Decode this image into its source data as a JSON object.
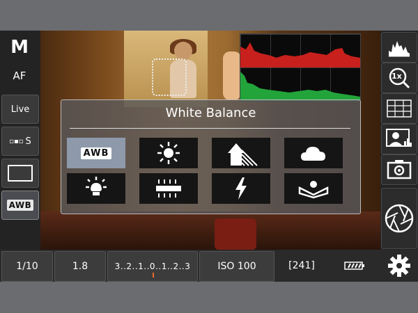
{
  "left_rail": {
    "mode": "M",
    "focus": "AF",
    "live": "Live",
    "drive": "S",
    "wb": "AWB"
  },
  "bottom_bar": {
    "shutter": "1/10",
    "aperture": "1.8",
    "exposure_scale": "3..2..1..0..1..2..3",
    "iso": "ISO 100",
    "shots_remaining": "[241]",
    "battery_icon": "battery-icon",
    "settings_icon": "gear-icon"
  },
  "white_balance": {
    "title": "White Balance",
    "selected": "AWB",
    "options": [
      {
        "id": "awb",
        "label": "AWB"
      },
      {
        "id": "daylight",
        "icon": "sun-icon"
      },
      {
        "id": "shade",
        "icon": "shade-house-icon"
      },
      {
        "id": "cloudy",
        "icon": "cloud-icon"
      },
      {
        "id": "tungsten",
        "icon": "tungsten-bulb-icon"
      },
      {
        "id": "fluorescent",
        "icon": "fluorescent-tube-icon"
      },
      {
        "id": "flash",
        "icon": "flash-icon"
      },
      {
        "id": "custom",
        "icon": "custom-wb-icon"
      }
    ]
  },
  "right_rail": {
    "icons": [
      "histogram-icon",
      "zoom-1x-icon",
      "grid-icon",
      "face-detect-icon",
      "camera-view-icon",
      "shutter-aperture-icon"
    ],
    "zoom_label": "1x"
  },
  "colors": {
    "accent_orange": "#e86a2a",
    "selected_wb": "#8e9aaa",
    "hist_red": "#c8201c",
    "hist_green": "#22a43a"
  }
}
